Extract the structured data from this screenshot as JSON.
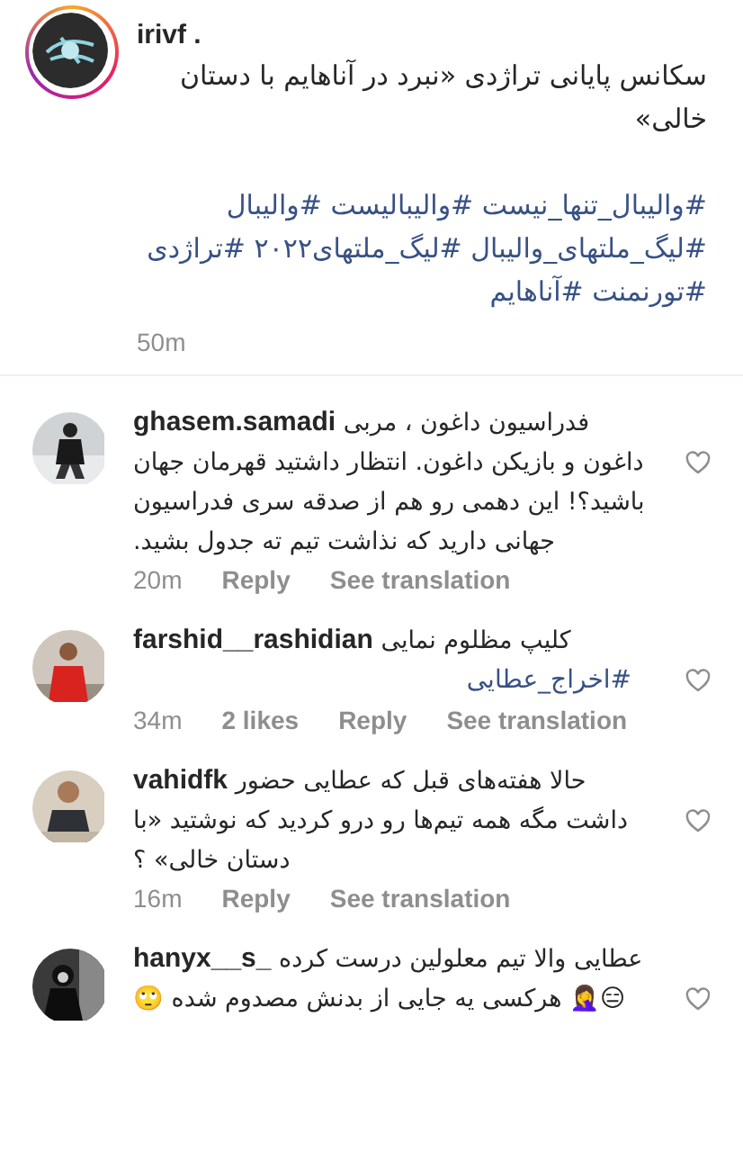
{
  "post": {
    "username": "irivf .",
    "caption": "سکانس پایانی تراژدی «نبرد در آناهایم با دستان خالی»",
    "hashtags": [
      "#والیبال_تنها_نیست",
      "#والیبالیست",
      "#والیبال",
      "#لیگ_ملتهای_والیبال",
      "#لیگ_ملتهای۲۰۲۲",
      "#تراژدی",
      "#تورنمنت",
      "#آناهایم"
    ],
    "time": "50m"
  },
  "comments": [
    {
      "username": "ghasem.samadi",
      "text": "فدراسیون داغون ، مربی داغون و بازیکن داغون. انتظار داشتید قهرمان جهان باشید؟! این دهمی رو هم از صدقه سری فدراسیون جهانی دارید که نذاشت تیم ته جدول بشید.",
      "time": "20m",
      "reply": "Reply",
      "translate": "See translation",
      "liked": false
    },
    {
      "username": "farshid__rashidian",
      "text": "کلیپ مظلوم نمایی",
      "hashtags": [
        "#اخراج_عطایی"
      ],
      "time": "34m",
      "likes": "2 likes",
      "reply": "Reply",
      "translate": "See translation",
      "liked": false
    },
    {
      "username": "vahidfk",
      "text": "حالا هفته‌های قبل که عطایی حضور داشت مگه همه تیم‌ها رو درو کردید که نوشتید «با دستان خالی» ؟",
      "time": "16m",
      "reply": "Reply",
      "translate": "See translation",
      "liked": false
    },
    {
      "username": "hanyx__s_",
      "text": "عطایی والا تیم معلولین درست کرده 😑🤦‍♀️ هرکسی یه جایی از بدنش مصدوم شده 🙄",
      "liked": false
    }
  ]
}
